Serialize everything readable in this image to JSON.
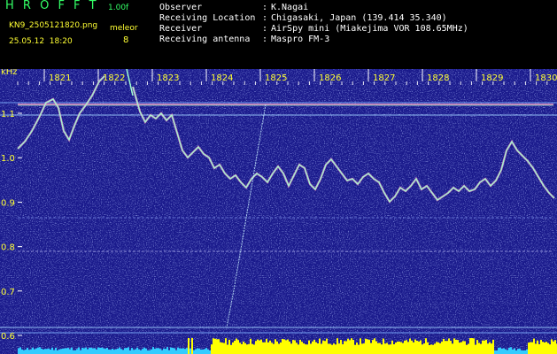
{
  "header": {
    "app_title": "H R O F F T",
    "app_version": "1.00f",
    "file_name": "KN9_2505121820.png",
    "date_time": "25.05.12  18:20",
    "meteor_label": "meleor",
    "meteor_count": "8",
    "info": [
      {
        "label": "Observer",
        "sep": ":",
        "value": "K.Nagai"
      },
      {
        "label": "Receiving Location",
        "sep": ":",
        "value": "Chigasaki, Japan (139.414 35.340)"
      },
      {
        "label": "Receiver",
        "sep": ":",
        "value": "AirSpy mini (Miakejima VOR 108.65MHz)"
      },
      {
        "label": "Receiving antenna",
        "sep": ":",
        "value": "Maspro FM-3"
      }
    ]
  },
  "axes": {
    "y_unit": "kHz",
    "y_ticks": [
      "1.1",
      "1.0",
      "0.9",
      "0.8",
      "0.7",
      "0.6"
    ],
    "x_ticks": [
      "1821",
      "1822",
      "1823",
      "1824",
      "1825",
      "1826",
      "1827",
      "1828",
      "1829",
      "1830"
    ]
  },
  "colors": {
    "background": "#1a1a8c",
    "noise_light": "#6f8cff",
    "trace": "#8fffcf",
    "bottom_bar_low": "#33ccff",
    "bottom_bar_high": "#ffff00",
    "header_green": "#33ff66",
    "header_yellow": "#ffff33"
  }
}
